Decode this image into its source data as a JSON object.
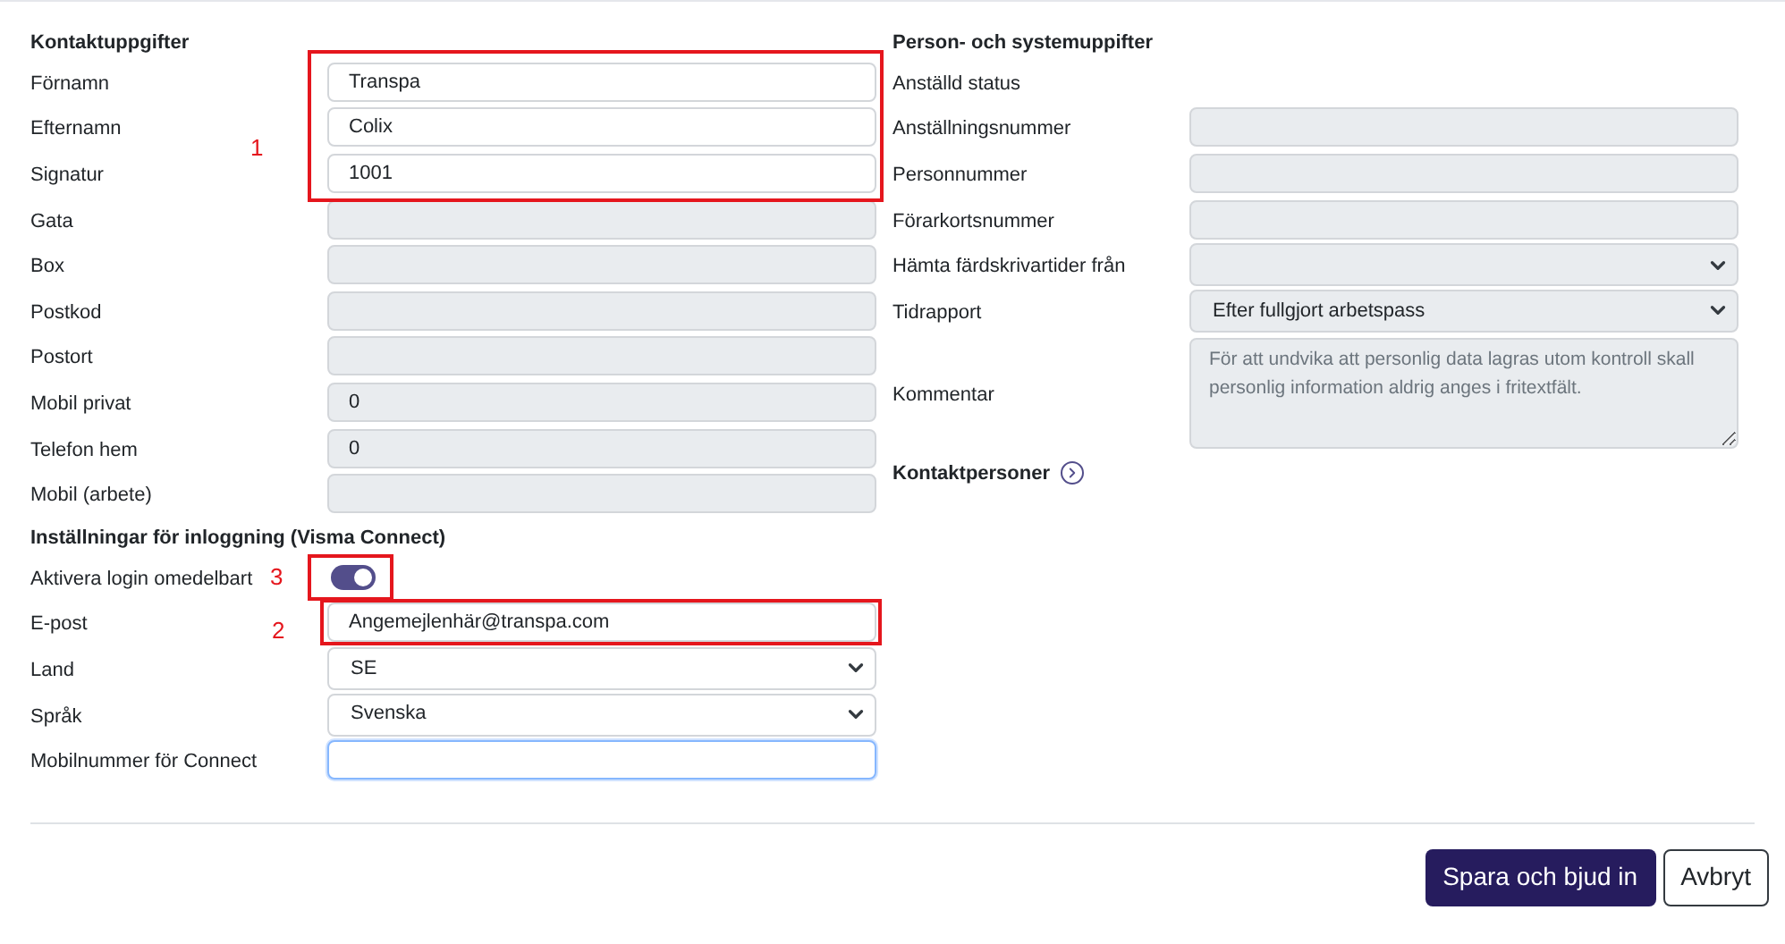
{
  "left": {
    "sections": [
      {
        "title": "Kontaktuppgifter",
        "rows": [
          {
            "label": "Förnamn",
            "kind": "text",
            "value": "Transpa",
            "disabled": false
          },
          {
            "label": "Efternamn",
            "kind": "text",
            "value": "Colix",
            "disabled": false
          },
          {
            "label": "Signatur",
            "kind": "text",
            "value": "1001",
            "disabled": false
          },
          {
            "label": "Gata",
            "kind": "text",
            "disabled": true
          },
          {
            "label": "Box",
            "kind": "text",
            "disabled": true
          },
          {
            "label": "Postkod",
            "kind": "text",
            "disabled": true
          },
          {
            "label": "Postort",
            "kind": "text",
            "disabled": true
          },
          {
            "label": "Mobil privat",
            "kind": "text",
            "value": "0",
            "disabled": true
          },
          {
            "label": "Telefon hem",
            "kind": "text",
            "value": "0",
            "disabled": true
          },
          {
            "label": "Mobil (arbete)",
            "kind": "text",
            "disabled": true
          }
        ]
      },
      {
        "title": "Inställningar för inloggning (Visma Connect)",
        "rows": [
          {
            "label": "Aktivera login omedelbart",
            "kind": "toggle",
            "on": true
          },
          {
            "label": "E-post",
            "kind": "text",
            "value": "Angemejlenhär@transpa.com",
            "disabled": false
          },
          {
            "label": "Land",
            "kind": "select",
            "value": "SE",
            "disabled": false
          },
          {
            "label": "Språk",
            "kind": "select",
            "value": "Svenska",
            "disabled": false
          },
          {
            "label": "Mobilnummer för Connect",
            "kind": "text",
            "disabled": false,
            "focused": true
          }
        ]
      }
    ]
  },
  "right": {
    "title": "Person- och systemuppifter",
    "rows": [
      {
        "label": "Anställd status",
        "kind": "none"
      },
      {
        "label": "Anställningsnummer",
        "kind": "text",
        "disabled": true
      },
      {
        "label": "Personnummer",
        "kind": "text",
        "disabled": true
      },
      {
        "label": "Förarkortsnummer",
        "kind": "text",
        "disabled": true
      },
      {
        "label": "Hämta färdskrivartider från",
        "kind": "select",
        "disabled": true
      },
      {
        "label": "Tidrapport",
        "kind": "select",
        "value": "Efter fullgjort arbetspass",
        "disabled": true
      },
      {
        "label": "Kommentar",
        "kind": "textarea",
        "placeholder": "För att undvika att personlig data lagras utom kontroll skall personlig information aldrig anges i fritextfält.",
        "disabled": true
      }
    ],
    "link": {
      "label": "Kontaktpersoner"
    }
  },
  "annotations": [
    {
      "number": "1"
    },
    {
      "number": "3"
    },
    {
      "number": "2"
    }
  ],
  "buttons": [
    {
      "label": "Spara och bjud in",
      "kind": "primary"
    },
    {
      "label": "Avbryt",
      "kind": "secondary"
    }
  ]
}
